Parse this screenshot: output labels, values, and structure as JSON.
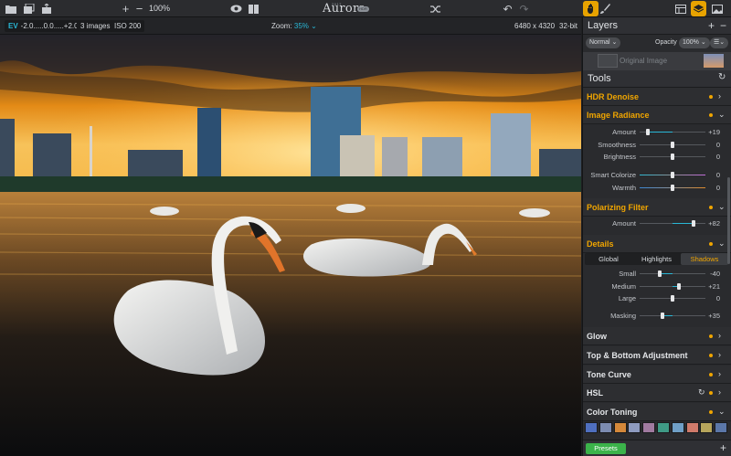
{
  "app": {
    "zoom_text": "100",
    "zoom_suffix": "%"
  },
  "toolbar": {
    "left_icons": [
      "folder-icon",
      "stack-icon",
      "share-icon",
      "plus-icon",
      "minus-icon"
    ],
    "logo_badge": "2017",
    "logo_text": "Aurora",
    "logo_pill": "HDR"
  },
  "infobar": {
    "ev_label": "EV",
    "ev_values": "-2.0.....0.0.....+2.0",
    "images": "3 images",
    "iso": "ISO 200",
    "zoom_label": "Zoom:",
    "zoom_value": "35%",
    "zoom_arrow": "⌄",
    "dimensions": "6480 x 4320",
    "bit_depth": "32-bit"
  },
  "layers": {
    "title": "Layers",
    "blend_mode": "Normal",
    "opacity_label": "Opacity",
    "opacity_value": "100%",
    "layer_name": "Original Image"
  },
  "tools": {
    "title": "Tools",
    "hdr_denoise": "HDR Denoise",
    "image_radiance": {
      "title": "Image Radiance",
      "sliders": [
        {
          "label": "Amount",
          "value": "+19",
          "pos": 0.12
        },
        {
          "label": "Smoothness",
          "value": "0",
          "pos": 0.5
        },
        {
          "label": "Brightness",
          "value": "0",
          "pos": 0.5
        }
      ],
      "sliders2": [
        {
          "label": "Smart Colorize",
          "value": "0",
          "pos": 0.5
        },
        {
          "label": "Warmth",
          "value": "0",
          "pos": 0.5
        }
      ]
    },
    "polarizing": {
      "title": "Polarizing Filter",
      "sliders": [
        {
          "label": "Amount",
          "value": "+82",
          "pos": 0.82
        }
      ]
    },
    "details": {
      "title": "Details",
      "tabs": [
        "Global",
        "Highlights",
        "Shadows"
      ],
      "active_tab": 2,
      "sliders": [
        {
          "label": "Small",
          "value": "-40",
          "pos": 0.3
        },
        {
          "label": "Medium",
          "value": "+21",
          "pos": 0.6
        },
        {
          "label": "Large",
          "value": "0",
          "pos": 0.5
        }
      ],
      "masking": {
        "label": "Masking",
        "value": "+35",
        "pos": 0.35
      }
    },
    "glow": "Glow",
    "top_bottom": "Top & Bottom Adjustment",
    "tone_curve": "Tone Curve",
    "hsl": "HSL",
    "color_toning": "Color Toning",
    "swatch_colors": [
      "#4f6fbf",
      "#7c8bb0",
      "#d4883a",
      "#8e9bbf",
      "#a07a9f",
      "#3f9a85",
      "#6f9fc6",
      "#cf7a6a",
      "#b6a55b",
      "#5b77a8"
    ]
  },
  "footer": {
    "presets": "Presets",
    "add": "+"
  },
  "colors": {
    "accent": "#f0a500",
    "cyan": "#29b7d6",
    "green": "#3bb34a"
  }
}
